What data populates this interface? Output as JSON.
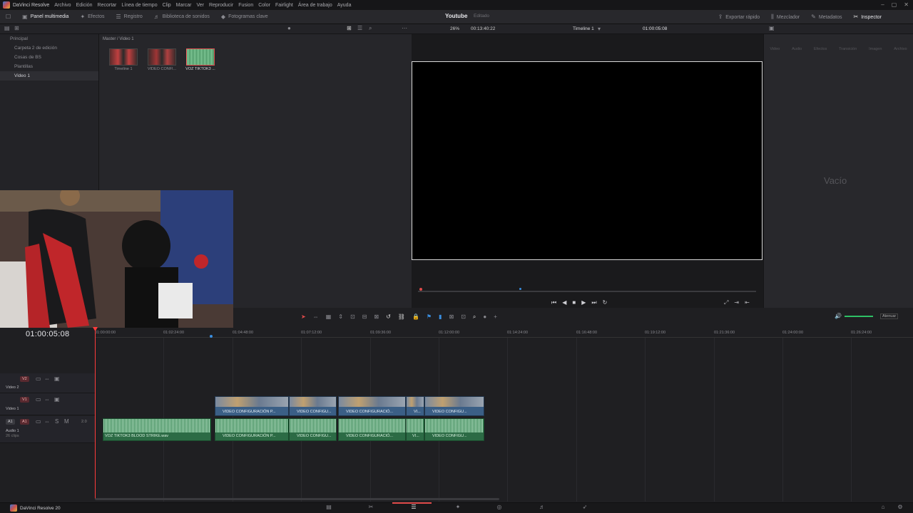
{
  "menubar": {
    "app_name": "DaVinci Resolve",
    "items": [
      "Archivo",
      "Edición",
      "Recortar",
      "Línea de tiempo",
      "Clip",
      "Marcar",
      "Ver",
      "Reproducir",
      "Fusion",
      "Color",
      "Fairlight",
      "Área de trabajo",
      "Ayuda"
    ]
  },
  "toolbar": {
    "left": [
      "Panel multimedia",
      "Efectos",
      "Registro",
      "Biblioteca de sonidos",
      "Fotogramas clave"
    ],
    "project_name": "Youtube",
    "project_status": "Editado",
    "right": [
      "Exportar rápido",
      "Mezclador",
      "Metadatos",
      "Inspector"
    ]
  },
  "subbar": {
    "zoom": "26%",
    "source_timecode": "00:13:40:22",
    "timeline_name": "Timeline 1",
    "record_timecode": "01:00:05:08"
  },
  "sidebar": {
    "items": [
      "Principal",
      "Carpeta 2 de edición",
      "Cosas de BS",
      "Plantillas",
      "Video 1"
    ],
    "selected": 4
  },
  "mediapool": {
    "breadcrumb": "Master / Video 1",
    "clips": [
      "Timeline 1",
      "VIDEO CONFI...",
      "VOZ TIKTOK3 ..."
    ]
  },
  "inspector": {
    "tabs": [
      "Video",
      "Audio",
      "Efectos",
      "Transición",
      "Imagen",
      "Archivo"
    ],
    "empty_text": "Vacío"
  },
  "timeline": {
    "timecode": "01:00:05:08",
    "ruler": [
      "01:00:00:00",
      "01:02:24:00",
      "01:04:48:00",
      "01:07:12:00",
      "01:09:36:00",
      "01:12:00:00",
      "01:14:24:00",
      "01:16:48:00",
      "01:19:12:00",
      "01:21:36:00",
      "01:24:00:00",
      "01:26:24:00"
    ],
    "tracks": {
      "v2": {
        "badge": "V2",
        "name": "Video 2"
      },
      "v1": {
        "badge": "V1",
        "name": "Video 1"
      },
      "a1": {
        "badge": "A1",
        "name": "Audio 1",
        "clips": "26 clips",
        "level": "2.0"
      }
    },
    "video_clips": [
      "VIDEO CONFIGURACIÓN P...",
      "VIDEO CONFIGU...",
      "VIDEO CONFIGURACIÓ...",
      "VI...",
      "VIDEO CONFIGU..."
    ],
    "audio_clips": [
      "VOZ TIKTOK3 BLOOD STRIKE.wav",
      "VIDEO CONFIGURACIÓN P...",
      "VIDEO CONFIGU...",
      "VIDEO CONFIGURACIÓ...",
      "VI...",
      "VIDEO CONFIGU..."
    ],
    "audio_label": "Atenuar"
  },
  "bottombar": {
    "app_label": "DaVinci Resolve 20"
  },
  "colors": {
    "accent_red": "#e04a4a",
    "playhead": "#ff3b3b",
    "video_clip": "#3b5f86",
    "audio_clip": "#2c6b45"
  }
}
